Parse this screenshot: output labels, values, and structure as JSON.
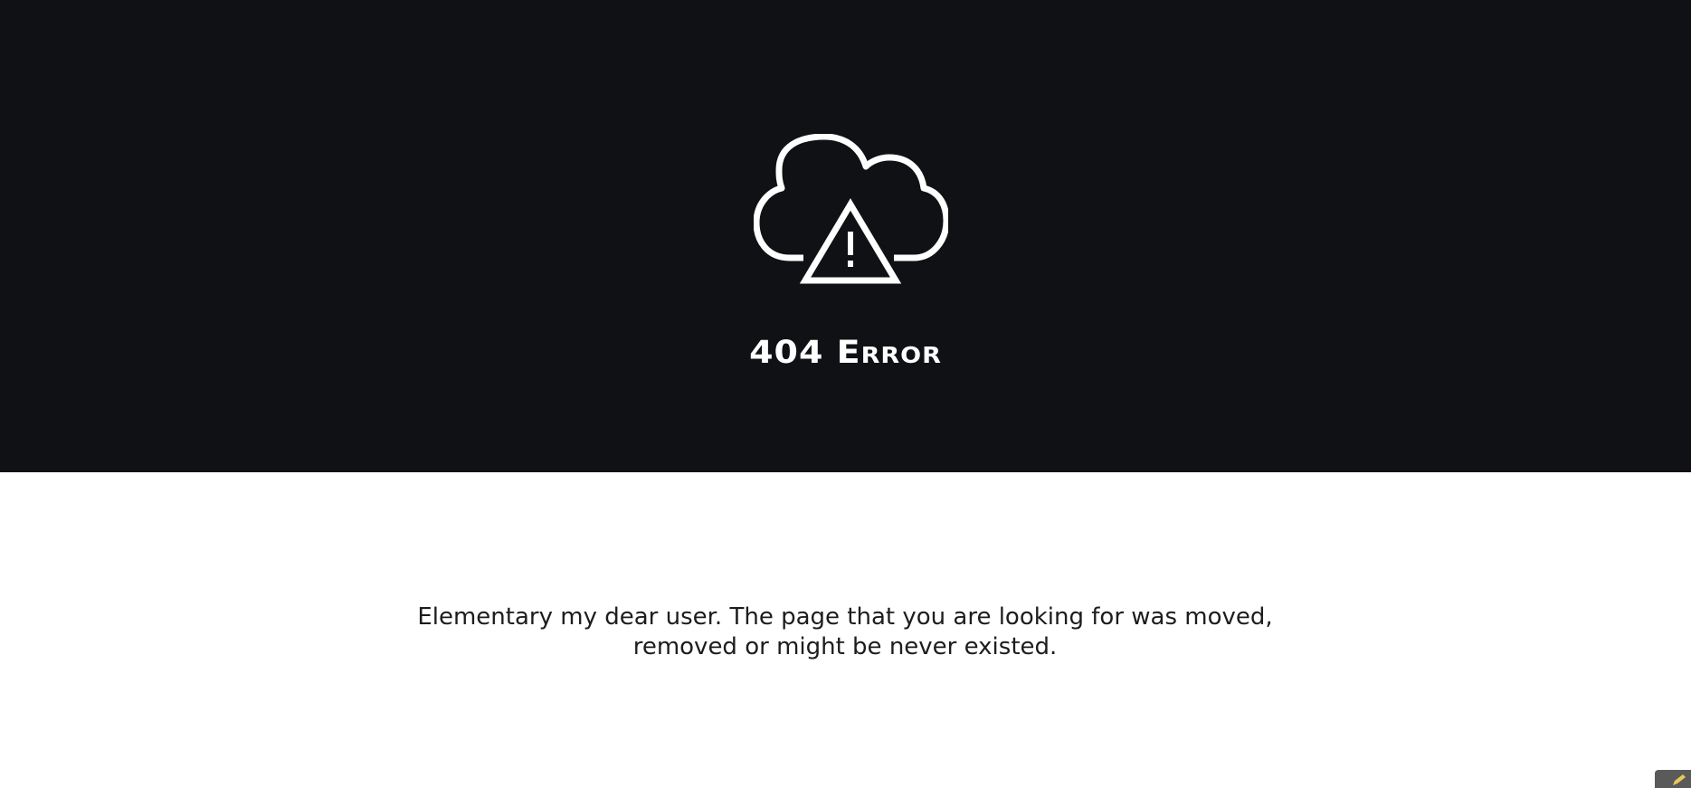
{
  "hero": {
    "icon": "cloud-warning-icon",
    "title": "404 Error",
    "background_color": "#101115",
    "foreground_color": "#ffffff"
  },
  "content": {
    "message_line1": "Elementary my dear user. The page that you are looking for was moved,",
    "message_line2": "removed or might be never existed.",
    "text_color": "#1d1d1f"
  },
  "corner_widget": {
    "icon": "pencil-icon"
  }
}
